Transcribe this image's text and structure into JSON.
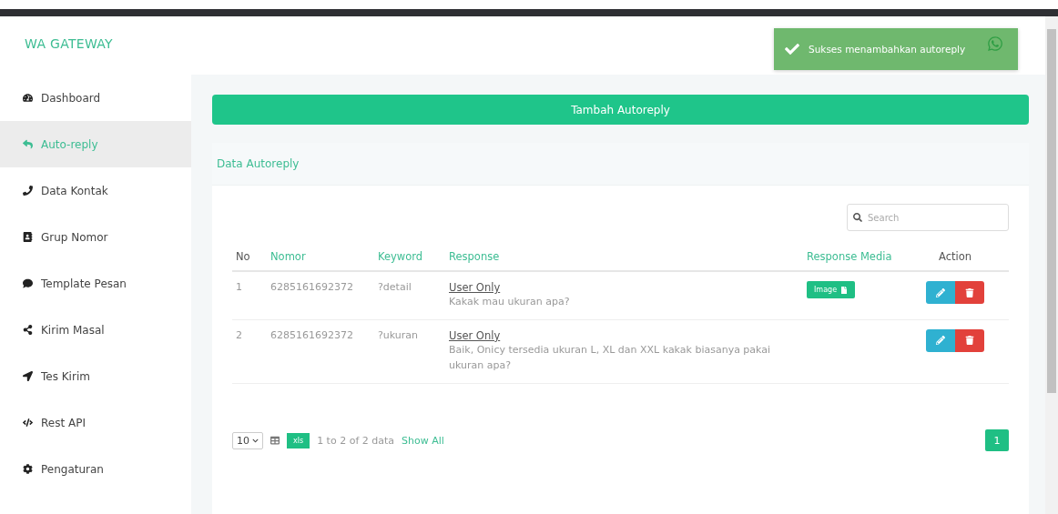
{
  "brand": "WA GATEWAY",
  "sidebar": {
    "items": [
      {
        "label": "Dashboard",
        "selected": false
      },
      {
        "label": "Auto-reply",
        "selected": true
      },
      {
        "label": "Data Kontak",
        "selected": false
      },
      {
        "label": "Grup Nomor",
        "selected": false
      },
      {
        "label": "Template Pesan",
        "selected": false
      },
      {
        "label": "Kirim Masal",
        "selected": false
      },
      {
        "label": "Tes Kirim",
        "selected": false
      },
      {
        "label": "Rest API",
        "selected": false
      },
      {
        "label": "Pengaturan",
        "selected": false
      }
    ]
  },
  "toast": {
    "message": "Sukses menambahkan autoreply"
  },
  "add_button": "Tambah Autoreply",
  "card": {
    "title": "Data Autoreply",
    "search": {
      "placeholder": "Search"
    },
    "table": {
      "columns": [
        {
          "label": "No",
          "sortable": false
        },
        {
          "label": "Nomor",
          "sortable": true
        },
        {
          "label": "Keyword",
          "sortable": true
        },
        {
          "label": "Response",
          "sortable": true
        },
        {
          "label": "Response Media",
          "sortable": true
        },
        {
          "label": "Action",
          "sortable": false
        }
      ],
      "rows": [
        {
          "no": "1",
          "nomor": "6285161692372",
          "keyword": "?detail",
          "response_type": "User Only",
          "response": "Kakak mau ukuran apa?",
          "media": "Image"
        },
        {
          "no": "2",
          "nomor": "6285161692372",
          "keyword": "?ukuran",
          "response_type": "User Only",
          "response": "Baik, Onicy tersedia ukuran L, XL dan XXL kakak biasanya pakai ukuran apa?"
        }
      ]
    },
    "footer": {
      "page_size": "10",
      "export": "xls",
      "info": "1 to 2 of 2 data",
      "show_all": "Show All",
      "pages": [
        {
          "label": "1",
          "selected": true
        }
      ]
    }
  }
}
